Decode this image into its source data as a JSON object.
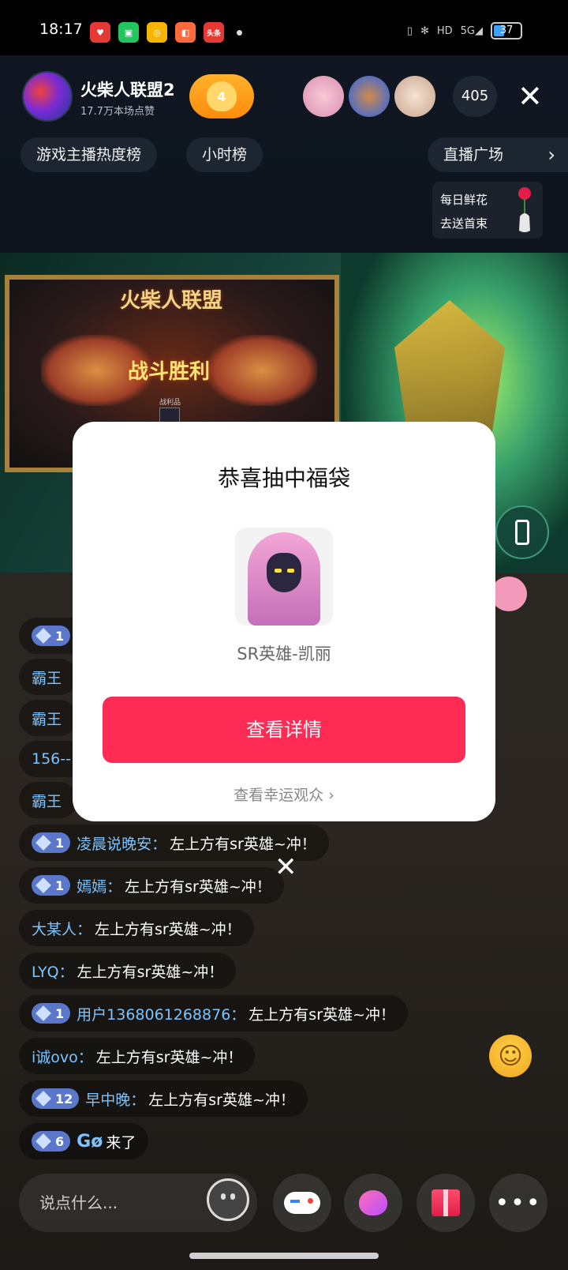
{
  "status": {
    "time": "18:17",
    "network": "5G",
    "hd": "HD",
    "battery_level": "37",
    "app_icons": [
      "app-heart-icon",
      "app-bag-icon",
      "app-pay-icon",
      "app-bookmark-icon",
      "app-toutiao-icon"
    ],
    "toutiao_label": "头条"
  },
  "header": {
    "streamer_name": "火柴人联盟2",
    "likes": "17.7万本场点赞",
    "fan_level": "4",
    "viewer_count": "405",
    "tabs": [
      "游戏主播热度榜",
      "小时榜"
    ],
    "plaza": "直播广场"
  },
  "flower_card": {
    "line1": "每日鲜花",
    "line2": "去送首束"
  },
  "video": {
    "game_title": "火柴人联盟",
    "victory": "战斗胜利",
    "loot_label": "战利品"
  },
  "dialog": {
    "title": "恭喜抽中福袋",
    "prize_name": "SR英雄-凯丽",
    "detail_button": "查看详情",
    "lucky_link": "查看幸运观众 ›"
  },
  "chat": [
    {
      "level": "1",
      "user": "",
      "msg": ""
    },
    {
      "level": "",
      "user": "霸王",
      "msg": ""
    },
    {
      "level": "",
      "user": "霸王",
      "msg": ""
    },
    {
      "level": "",
      "user": "156--",
      "msg": ""
    },
    {
      "level": "",
      "user": "霸王",
      "msg": ""
    },
    {
      "level": "1",
      "user": "凌晨说晚安：",
      "msg": "左上方有sr英雄~冲！"
    },
    {
      "level": "1",
      "user": "嫣嫣：",
      "msg": "左上方有sr英雄~冲！"
    },
    {
      "level": "",
      "user": "大某人：",
      "msg": "左上方有sr英雄~冲！"
    },
    {
      "level": "",
      "user": "LYQ：",
      "msg": "左上方有sr英雄~冲！"
    },
    {
      "level": "1",
      "user": "用户1368061268876：",
      "msg": "左上方有sr英雄~冲！"
    },
    {
      "level": "",
      "user": "i诚ovo：",
      "msg": "左上方有sr英雄~冲！"
    },
    {
      "level": "12",
      "user": "早中晚：",
      "msg": "左上方有sr英雄~冲！"
    },
    {
      "level": "6",
      "user": "Gø",
      "msg": "来了"
    }
  ],
  "bottom": {
    "input_placeholder": "说点什么...",
    "more": "•••"
  },
  "colors": {
    "accent": "#fe2c55",
    "username": "#7cc4ff",
    "level_badge": "#5b77c9"
  }
}
